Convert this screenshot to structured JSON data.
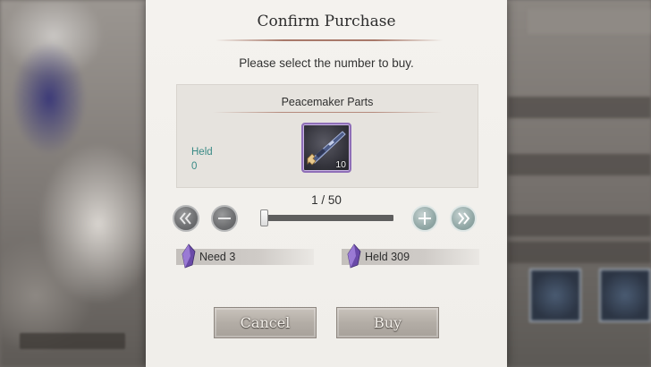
{
  "dialog": {
    "title": "Confirm Purchase",
    "prompt": "Please select the number to buy."
  },
  "item": {
    "name": "Peacemaker Parts",
    "held_label": "Held",
    "held_value": "0",
    "icon": "gun-parts-icon",
    "count": "10"
  },
  "quantity": {
    "text": "1 / 50",
    "current": 1,
    "max": 50,
    "buttons": {
      "min": "double-chevron-left-icon",
      "decrement": "minus-icon",
      "increment": "plus-icon",
      "max": "double-chevron-right-icon"
    }
  },
  "currency": {
    "icon": "purple-crystal-icon",
    "need_label": "Need 3",
    "held_label": "Held  309"
  },
  "actions": {
    "cancel_label": "Cancel",
    "buy_label": "Buy"
  },
  "colors": {
    "accent_teal": "#3a8a86",
    "rule": "#a8796a",
    "item_frame": "#8f6fb8"
  }
}
